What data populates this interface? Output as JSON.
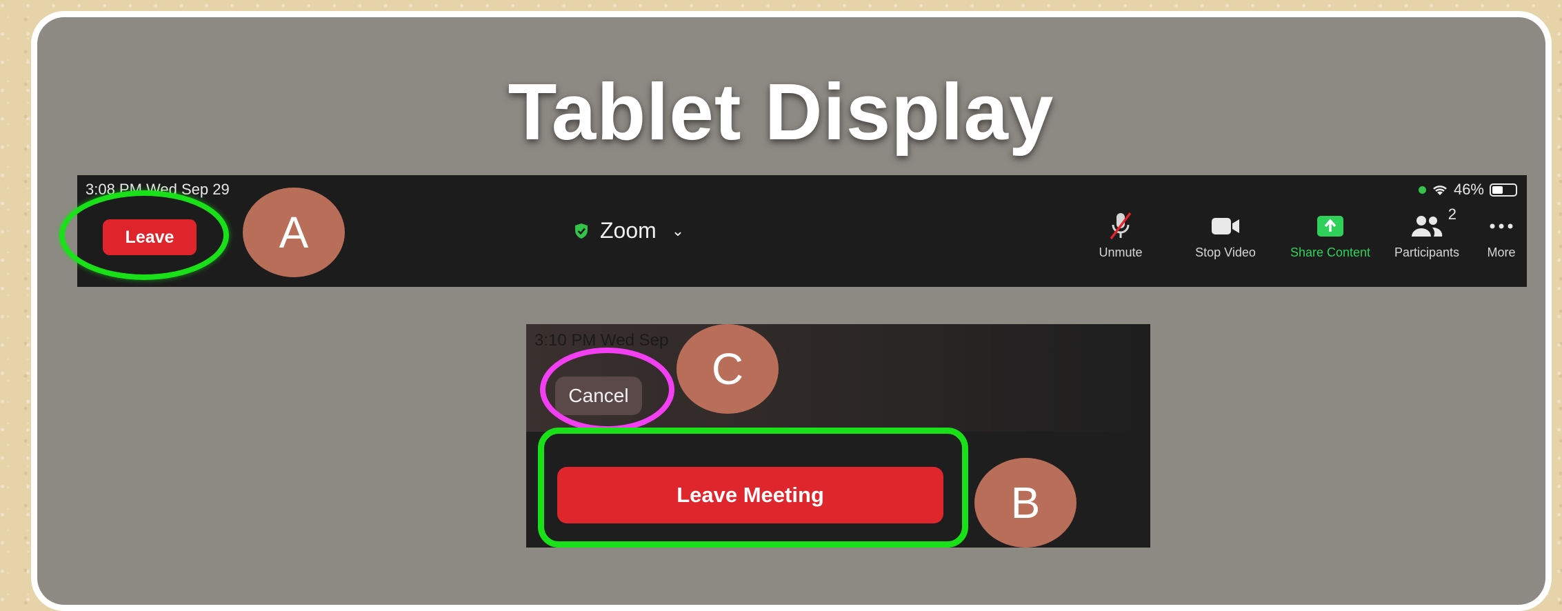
{
  "slide": {
    "title": "Tablet Display"
  },
  "topbar": {
    "status_time": "3:08 PM   Wed Sep 29",
    "battery": "46%",
    "battery_level": 0.46,
    "leave_label": "Leave",
    "meeting_title": "Zoom",
    "tools": [
      {
        "label": "Unmute",
        "icon": "muted-mic-icon"
      },
      {
        "label": "Stop Video",
        "icon": "video-camera-icon"
      },
      {
        "label": "Share Content",
        "icon": "share-arrow-icon"
      },
      {
        "label": "Participants",
        "icon": "participants-icon",
        "count": "2"
      },
      {
        "label": "More",
        "icon": "more-dots-icon"
      }
    ]
  },
  "modal": {
    "status_time": "3:10 PM   Wed Sep",
    "cancel_label": "Cancel",
    "leave_meeting_label": "Leave Meeting"
  },
  "callouts": {
    "a": "A",
    "b": "B",
    "c": "C"
  },
  "colors": {
    "leave_red": "#e0242b",
    "highlight_green": "#1ae01a",
    "highlight_magenta": "#f23ff2",
    "badge": "#b96e5a",
    "share_green": "#2fd15b"
  }
}
